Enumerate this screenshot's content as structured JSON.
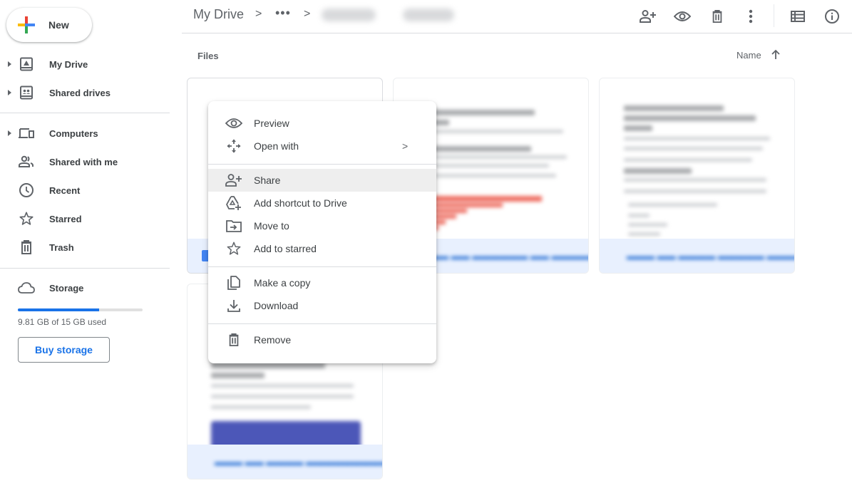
{
  "sidebar": {
    "new_label": "New",
    "items": [
      {
        "label": "My Drive",
        "icon": "my-drive-icon",
        "expandable": true
      },
      {
        "label": "Shared drives",
        "icon": "shared-drives-icon",
        "expandable": true
      },
      {
        "label": "Computers",
        "icon": "computers-icon",
        "expandable": true
      },
      {
        "label": "Shared with me",
        "icon": "shared-with-me-icon",
        "expandable": false
      },
      {
        "label": "Recent",
        "icon": "clock-icon",
        "expandable": false
      },
      {
        "label": "Starred",
        "icon": "star-icon",
        "expandable": false
      },
      {
        "label": "Trash",
        "icon": "trash-icon",
        "expandable": false
      }
    ],
    "storage": {
      "label": "Storage",
      "used_text": "9.81 GB of 15 GB used",
      "used_fraction": 0.654,
      "buy_label": "Buy storage"
    }
  },
  "header": {
    "breadcrumb_root": "My Drive",
    "breadcrumb_more": "•••",
    "breadcrumb_sep": ">",
    "toolbar_icons": [
      "share-icon",
      "preview-icon",
      "trash-icon",
      "more-vert-icon",
      "list-view-icon",
      "info-icon"
    ]
  },
  "main": {
    "section_label": "Files",
    "sort_label": "Name",
    "sort_direction": "ascending"
  },
  "context_menu": {
    "groups": [
      [
        {
          "label": "Preview",
          "icon": "eye-icon"
        },
        {
          "label": "Open with",
          "icon": "open-with-icon",
          "submenu": true
        }
      ],
      [
        {
          "label": "Share",
          "icon": "share-icon",
          "highlighted": true
        },
        {
          "label": "Add shortcut to Drive",
          "icon": "add-shortcut-icon"
        },
        {
          "label": "Move to",
          "icon": "move-to-icon"
        },
        {
          "label": "Add to starred",
          "icon": "star-icon"
        }
      ],
      [
        {
          "label": "Make a copy",
          "icon": "copy-icon"
        },
        {
          "label": "Download",
          "icon": "download-icon"
        }
      ],
      [
        {
          "label": "Remove",
          "icon": "trash-icon"
        }
      ]
    ],
    "submenu_chevron": ">"
  },
  "colors": {
    "accent": "#1a73e8",
    "hover_bg": "#eeeeee",
    "card_footer": "#e8f0fe"
  }
}
